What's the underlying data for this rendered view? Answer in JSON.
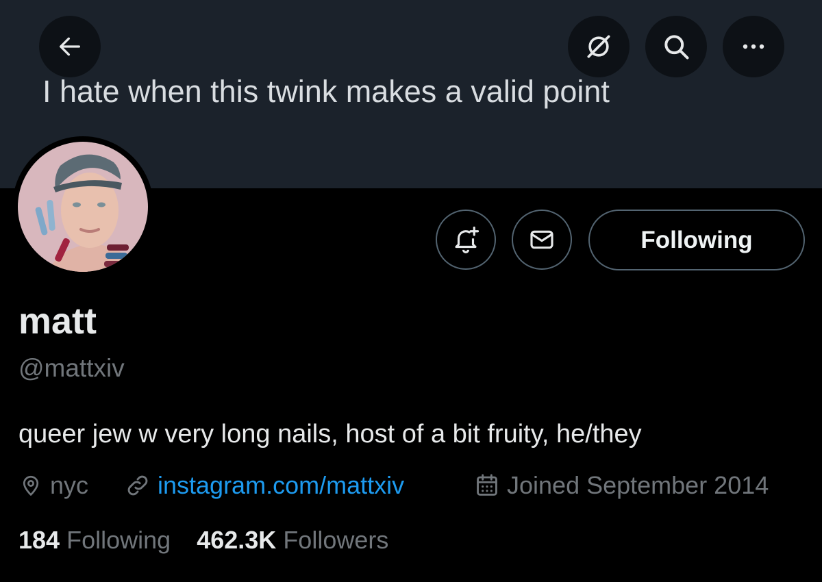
{
  "banner": {
    "text": "I hate when this twink makes a valid point"
  },
  "header_icons": [
    "back-arrow-icon",
    "grok-icon",
    "search-icon",
    "more-icon"
  ],
  "profile": {
    "name": "matt",
    "handle": "@mattxiv",
    "bio": "queer jew w very long nails, host of a bit fruity, he/they",
    "location": "nyc",
    "website": "instagram.com/mattxiv",
    "joined": "Joined September 2014"
  },
  "actions": {
    "following_label": "Following"
  },
  "stats": {
    "following_count": "184",
    "following_label": "Following",
    "followers_count": "462.3K",
    "followers_label": "Followers"
  },
  "colors": {
    "background": "#000000",
    "banner": "#1b222b",
    "link": "#1d9bf0",
    "muted": "#71767b"
  }
}
